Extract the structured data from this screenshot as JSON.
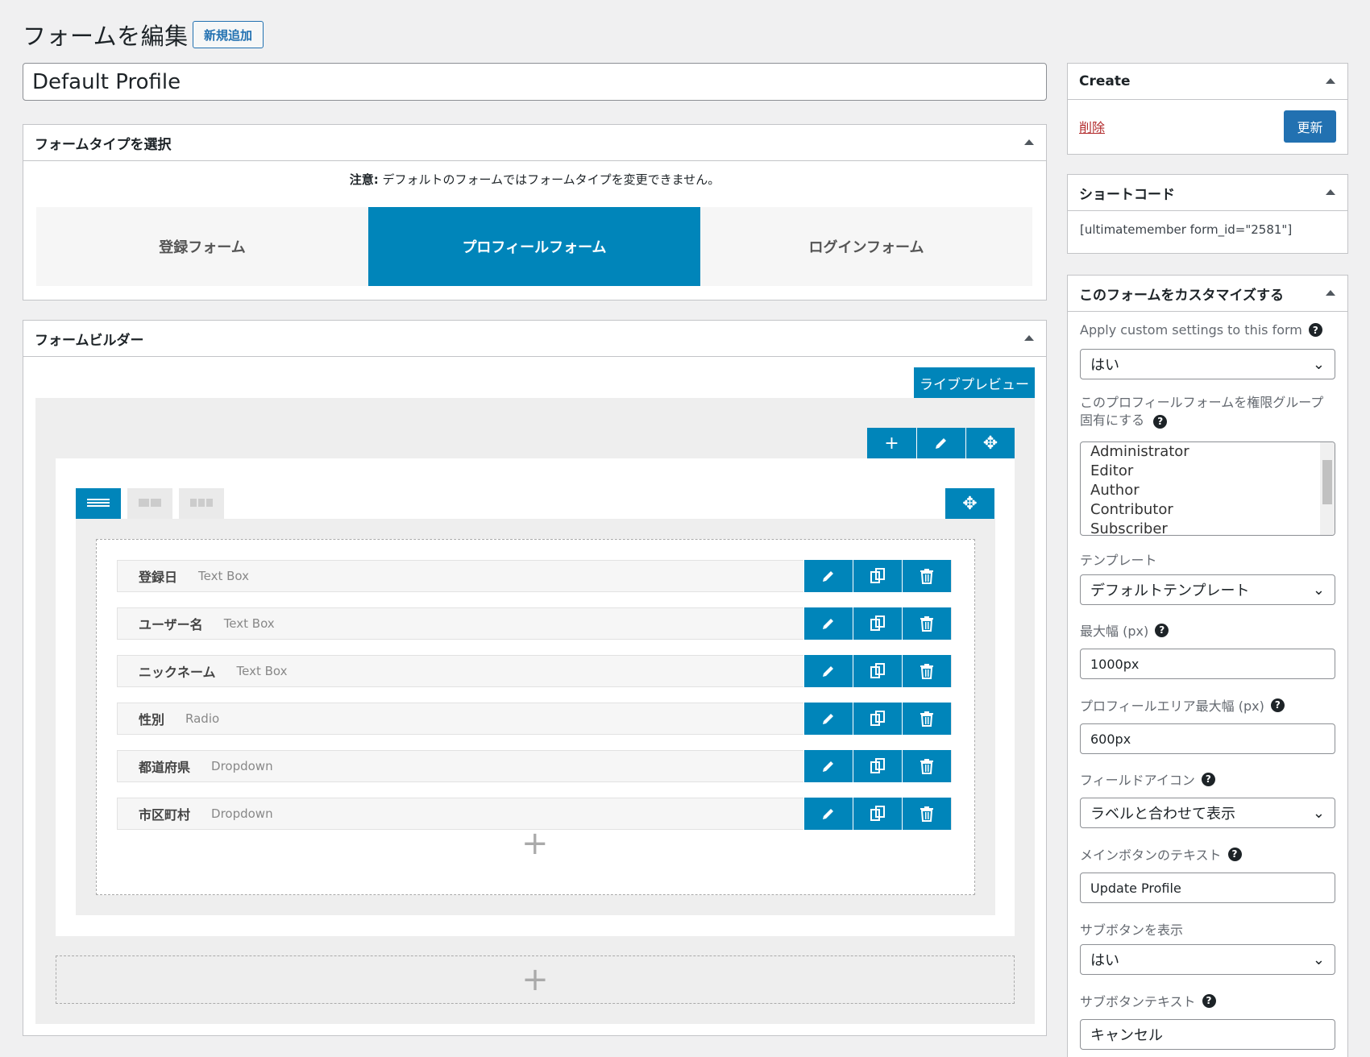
{
  "header": {
    "title": "フォームを編集",
    "add_new": "新規追加"
  },
  "form_title": "Default Profile",
  "form_type": {
    "heading": "フォームタイプを選択",
    "notice_bold": "注意:",
    "notice_text": " デフォルトのフォームではフォームタイプを変更できません。",
    "types": [
      "登録フォーム",
      "プロフィールフォーム",
      "ログインフォーム"
    ],
    "active_index": 1
  },
  "builder": {
    "heading": "フォームビルダー",
    "live_preview": "ライブプレビュー",
    "fields": [
      {
        "label": "登録日",
        "type": "Text Box"
      },
      {
        "label": "ユーザー名",
        "type": "Text Box"
      },
      {
        "label": "ニックネーム",
        "type": "Text Box"
      },
      {
        "label": "性別",
        "type": "Radio"
      },
      {
        "label": "都道府県",
        "type": "Dropdown"
      },
      {
        "label": "市区町村",
        "type": "Dropdown"
      }
    ]
  },
  "create_box": {
    "heading": "Create",
    "delete": "削除",
    "update": "更新"
  },
  "shortcode_box": {
    "heading": "ショートコード",
    "code": "[ultimatemember form_id=\"2581\"]"
  },
  "customize_box": {
    "heading": "このフォームをカスタマイズする",
    "apply_label": "Apply custom settings to this form",
    "apply_value": "はい",
    "roles_label_1": "このプロフィールフォームを権限グループ",
    "roles_label_2": "固有にする",
    "roles": [
      "Administrator",
      "Editor",
      "Author",
      "Contributor",
      "Subscriber"
    ],
    "template_label": "テンプレート",
    "template_value": "デフォルトテンプレート",
    "max_width_label": "最大幅 (px)",
    "max_width_value": "1000px",
    "profile_area_label": "プロフィールエリア最大幅 (px)",
    "profile_area_value": "600px",
    "field_icon_label": "フィールドアイコン",
    "field_icon_value": "ラベルと合わせて表示",
    "main_btn_label": "メインボタンのテキスト",
    "main_btn_value": "Update Profile",
    "show_sub_label": "サブボタンを表示",
    "show_sub_value": "はい",
    "sub_text_label": "サブボタンテキスト",
    "sub_text_value": "キャンセル"
  }
}
